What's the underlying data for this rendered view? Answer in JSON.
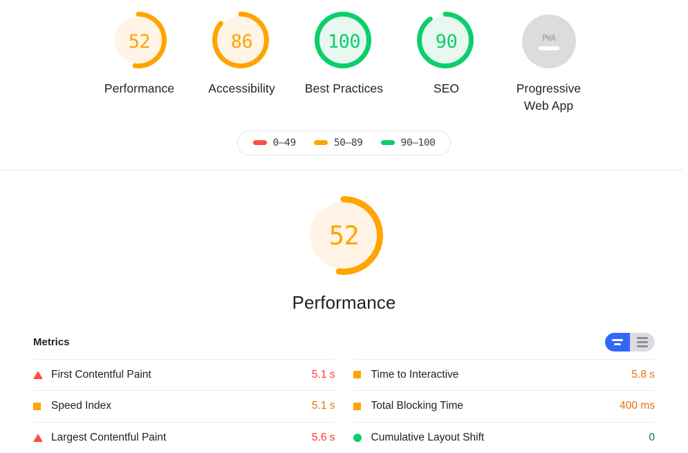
{
  "colors": {
    "fail": "#ff4e42",
    "average": "#ffa400",
    "pass": "#0cce6b",
    "fail_text": "#f33",
    "average_text": "#e8710a",
    "pass_text": "#0a7d3f",
    "null_gray": "#dcdcdc",
    "toggle_active": "#3367f7",
    "toggle_inactive": "#dadce0"
  },
  "gauges": [
    {
      "score": "52",
      "label": "Performance",
      "rating": "average",
      "percent": 52,
      "type": "arc"
    },
    {
      "score": "86",
      "label": "Accessibility",
      "rating": "average",
      "percent": 86,
      "type": "arc"
    },
    {
      "score": "100",
      "label": "Best Practices",
      "rating": "pass",
      "percent": 100,
      "type": "arc"
    },
    {
      "score": "90",
      "label": "SEO",
      "rating": "pass",
      "percent": 90,
      "type": "arc"
    },
    {
      "score": "PWA",
      "label": "Progressive\nWeb App",
      "rating": "null",
      "percent": 0,
      "type": "pwa"
    }
  ],
  "legend": {
    "items": [
      {
        "range": "0–49",
        "rating": "fail",
        "color": "#ff4e42"
      },
      {
        "range": "50–89",
        "rating": "average",
        "color": "#ffa400"
      },
      {
        "range": "90–100",
        "rating": "pass",
        "color": "#0cce6b"
      }
    ]
  },
  "category": {
    "score": "52",
    "title": "Performance",
    "rating": "average",
    "percent": 52
  },
  "metrics": {
    "heading": "Metrics",
    "toggle": {
      "compact_icon": "filmstrip-view-icon",
      "compact_label": "Compact view",
      "expanded_icon": "list-view-icon",
      "expanded_label": "Expanded view",
      "active": "compact"
    },
    "left_column": [
      {
        "name": "First Contentful Paint",
        "value": "5.1 s",
        "rating": "fail",
        "shape": "triangle"
      },
      {
        "name": "Speed Index",
        "value": "5.1 s",
        "rating": "average",
        "shape": "square"
      },
      {
        "name": "Largest Contentful Paint",
        "value": "5.6 s",
        "rating": "fail",
        "shape": "triangle"
      }
    ],
    "right_column": [
      {
        "name": "Time to Interactive",
        "value": "5.8 s",
        "rating": "average",
        "shape": "square"
      },
      {
        "name": "Total Blocking Time",
        "value": "400 ms",
        "rating": "average",
        "shape": "square"
      },
      {
        "name": "Cumulative Layout Shift",
        "value": "0",
        "rating": "pass",
        "shape": "circle"
      }
    ]
  }
}
